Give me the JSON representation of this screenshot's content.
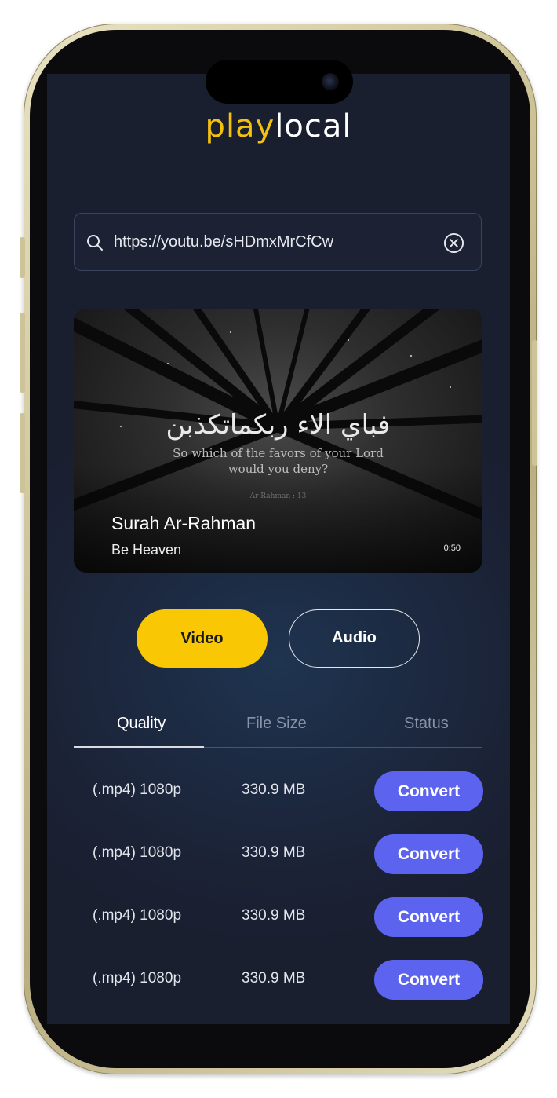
{
  "app": {
    "logo_part1": "play",
    "logo_part2": "local",
    "brand_color": "#f4c20d"
  },
  "search": {
    "value": "https://youtu.be/sHDmxMrCfCw",
    "icon": "search-icon",
    "clear_icon": "close-circle-icon"
  },
  "video": {
    "overlay_arabic": "فباي الاء ربكماتكذبن",
    "overlay_translation_line1": "So which of the favors of your Lord",
    "overlay_translation_line2": "would you deny?",
    "overlay_reference": "Ar Rahman : 13",
    "title": "Surah Ar-Rahman",
    "channel": "Be Heaven",
    "duration": "0:50"
  },
  "format_toggle": {
    "video_label": "Video",
    "audio_label": "Audio",
    "selected": "Video",
    "accent_color": "#f9c704"
  },
  "tabs": {
    "quality": "Quality",
    "file_size": "File Size",
    "status": "Status",
    "active": "Quality"
  },
  "rows": [
    {
      "quality": "(.mp4) 1080p",
      "size": "330.9 MB",
      "action": "Convert"
    },
    {
      "quality": "(.mp4) 1080p",
      "size": "330.9 MB",
      "action": "Convert"
    },
    {
      "quality": "(.mp4) 1080p",
      "size": "330.9 MB",
      "action": "Convert"
    },
    {
      "quality": "(.mp4) 1080p",
      "size": "330.9 MB",
      "action": "Convert"
    }
  ],
  "colors": {
    "convert_button": "#5b63ef",
    "background": "#1c2a42"
  }
}
